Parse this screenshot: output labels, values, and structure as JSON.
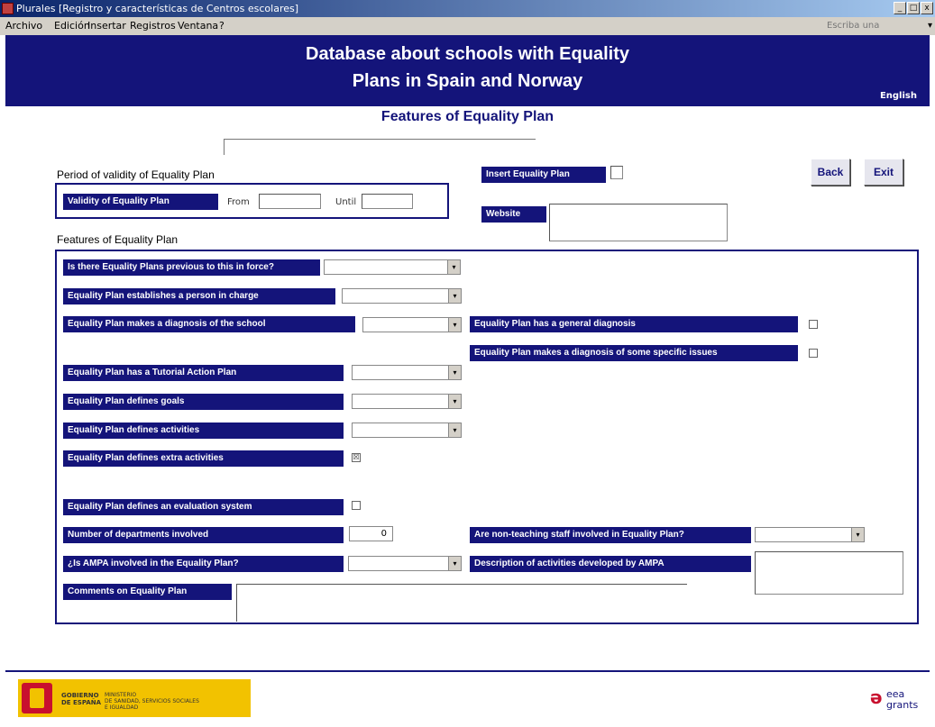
{
  "window": {
    "title": "Plurales  [Registro y características de Centros escolares]",
    "minimize": "_",
    "maximize": "□",
    "close": "x"
  },
  "menu": {
    "items": [
      "Archivo",
      "Edición",
      "Insertar",
      "Registros",
      "Ventana",
      "?"
    ],
    "help_placeholder": "Escriba una pregunta",
    "help_arrow": "▾"
  },
  "header": {
    "title_line1": "Database about schools with Equality",
    "title_line2": "Plans in Spain and Norway",
    "language_link": "English"
  },
  "form": {
    "subtitle": "Features of Equality Plan",
    "period_heading": "Period of validity of Equality Plan",
    "validity_label": "Validity of Equality Plan",
    "from_label": "From",
    "until_label": "Until",
    "insert_plan_label": "Insert Equality Plan",
    "website_label": "Website",
    "back_button": "Back",
    "exit_button": "Exit",
    "features_heading": "Features of Equality Plan",
    "q_previous_plans": "Is there Equality Plans previous to this in force?",
    "q_person_in_charge": "Equality Plan establishes a person in charge",
    "q_diagnosis": "Equality Plan makes a diagnosis of the school",
    "q_general_diagnosis": "Equality Plan has a general diagnosis",
    "q_specific_diagnosis": "Equality Plan makes a diagnosis of some specific issues",
    "q_tutorial_plan": "Equality Plan has a Tutorial Action Plan",
    "q_goals": "Equality Plan defines goals",
    "q_activities": "Equality Plan defines activities",
    "q_extra_activities": "Equality Plan defines extra activities",
    "q_evaluation": "Equality Plan defines an evaluation system",
    "q_departments": "Number of departments involved",
    "departments_value": "0",
    "q_non_teaching": "Are non-teaching staff involved in Equality Plan?",
    "q_ampa": "¿Is AMPA involved in the Equality Plan?",
    "q_ampa_activities": "Description of activities developed by AMPA",
    "comments_label": "Comments on Equality Plan",
    "extra_activities_checked": "☒",
    "combo_arrow": "▾"
  },
  "footer": {
    "gov_name_1": "GOBIERNO",
    "gov_name_2": "DE ESPAÑA",
    "ministry_1": "MINISTERIO",
    "ministry_2": "DE SANIDAD, SERVICIOS SOCIALES",
    "ministry_3": "E IGUALDAD",
    "eea_word1": "eea",
    "eea_word2": "grants"
  },
  "colors": {
    "brand_navy": "#14147a",
    "gov_yellow": "#f2c200",
    "gov_red": "#c8102e"
  }
}
